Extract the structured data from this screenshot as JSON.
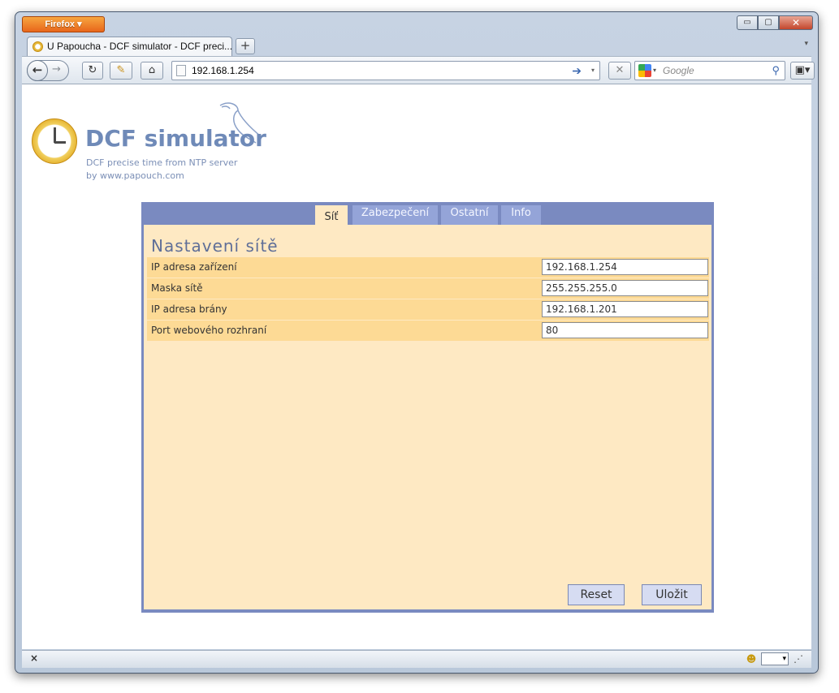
{
  "browser": {
    "app_button": "Firefox",
    "window_controls": {
      "minimize": "▭",
      "maximize": "▢",
      "close": "✕"
    },
    "tab": {
      "title": "U Papoucha - DCF simulator - DCF preci..."
    },
    "new_tab": "+",
    "url": "192.168.1.254",
    "search_placeholder": "Google",
    "status_left": "×"
  },
  "page": {
    "logo": {
      "title": "DCF simulator",
      "subtitle_line1": "DCF precise time from NTP server",
      "subtitle_line2": "by www.papouch.com"
    },
    "tabs": [
      {
        "label": "Síť",
        "active": true
      },
      {
        "label": "Zabezpečení",
        "active": false
      },
      {
        "label": "Ostatní",
        "active": false
      },
      {
        "label": "Info",
        "active": false
      }
    ],
    "section_title": "Nastavení sítě",
    "fields": [
      {
        "label": "IP adresa zařízení",
        "value": "192.168.1.254"
      },
      {
        "label": "Maska sítě",
        "value": "255.255.255.0"
      },
      {
        "label": "IP adresa brány",
        "value": "192.168.1.201"
      },
      {
        "label": "Port webového rozhraní",
        "value": "80"
      }
    ],
    "buttons": {
      "reset": "Reset",
      "save": "Uložit"
    }
  },
  "colors": {
    "panel_border": "#7a8ac0",
    "panel_bg": "#fee9c3",
    "row_bg": "#fdda95",
    "logo_text": "#6f8ab8",
    "firefox_orange": "#e8661b"
  }
}
